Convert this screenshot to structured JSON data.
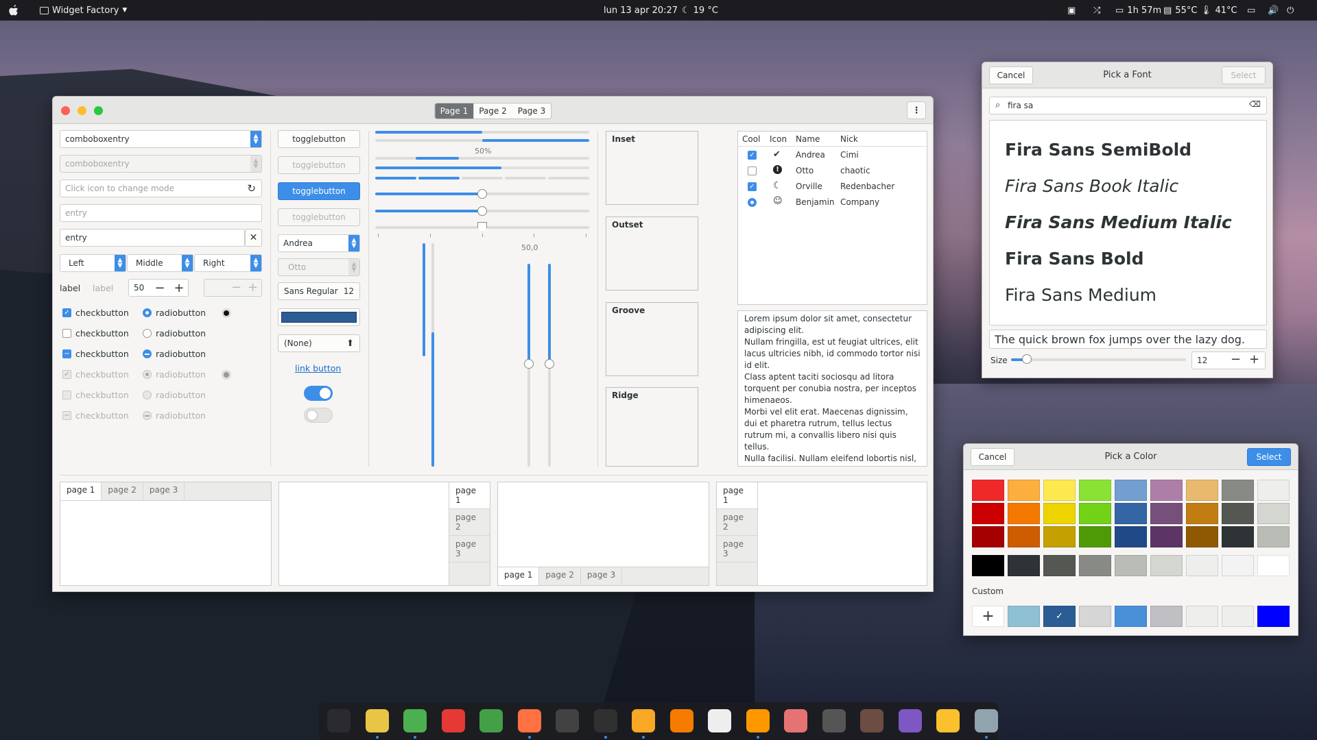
{
  "topbar": {
    "app_name": "Widget Factory",
    "datetime": "lun 13 apr  20:27",
    "weather": "19 °C",
    "battery": "1h 57m",
    "cpu_temp": "55°C",
    "gpu_temp": "41°C"
  },
  "main_window": {
    "stack_tabs": [
      "Page 1",
      "Page 2",
      "Page 3"
    ],
    "col1": {
      "combo1": "comboboxentry",
      "combo2": "comboboxentry",
      "mode_placeholder": "Click icon to change mode",
      "entry_placeholder": "entry",
      "entry_value": "entry",
      "segments": [
        "Left",
        "Middle",
        "Right"
      ],
      "label1": "label",
      "label2": "label",
      "spin_value": "50",
      "checks": [
        "checkbutton",
        "checkbutton",
        "checkbutton",
        "checkbutton",
        "checkbutton",
        "checkbutton"
      ],
      "radios": [
        "radiobutton",
        "radiobutton",
        "radiobutton",
        "radiobutton",
        "radiobutton",
        "radiobutton"
      ]
    },
    "col2": {
      "toggles": [
        "togglebutton",
        "togglebutton",
        "togglebutton",
        "togglebutton"
      ],
      "combo_active": "Andrea",
      "combo_disabled": "Otto",
      "font_name": "Sans Regular",
      "font_size": "12",
      "color_value": "#2b5c94",
      "file_value": "(None)",
      "link": "link button",
      "switch_on": true,
      "switch_off": false
    },
    "col3": {
      "progress_label": "50%",
      "scale_value": "50,0",
      "progress1": 0.5,
      "scale1": 0.5,
      "scale2": 0.5
    },
    "frames": [
      "Inset",
      "Outset",
      "Groove",
      "Ridge"
    ],
    "tree": {
      "headers": [
        "Cool",
        "Icon",
        "Name",
        "Nick"
      ],
      "rows": [
        {
          "name": "Andrea",
          "nick": "Cimi",
          "check": "on",
          "icon": "check-circle-icon"
        },
        {
          "name": "Otto",
          "nick": "chaotic",
          "check": "off",
          "icon": "exclamation-icon"
        },
        {
          "name": "Orville",
          "nick": "Redenbacher",
          "check": "on",
          "icon": "moon-icon"
        },
        {
          "name": "Benjamin",
          "nick": "Company",
          "check": "radio",
          "icon": "face-icon"
        }
      ]
    },
    "lorem": [
      "Lorem ipsum dolor sit amet, consectetur adipiscing elit.",
      "Nullam fringilla, est ut feugiat ultrices, elit lacus ultricies nibh, id commodo tortor nisi id elit.",
      "Class aptent taciti sociosqu ad litora torquent per conubia nostra, per inceptos himenaeos.",
      "Morbi vel elit erat. Maecenas dignissim, dui et pharetra rutrum, tellus lectus rutrum mi, a convallis libero nisi quis tellus.",
      "Nulla facilisi. Nullam eleifend lobortis nisl, in porttitor tellus malesuada vitae."
    ],
    "notebook_tabs": [
      "page 1",
      "page 2",
      "page 3"
    ]
  },
  "font_dialog": {
    "title": "Pick a Font",
    "cancel": "Cancel",
    "select": "Select",
    "search": "fira sa",
    "fonts": [
      "Fira Sans SemiBold",
      "Fira Sans Book Italic",
      "Fira Sans Medium Italic",
      "Fira Sans Bold",
      "Fira Sans Medium"
    ],
    "preview": "The quick brown fox jumps over the lazy dog.",
    "size_label": "Size",
    "size_value": "12"
  },
  "color_dialog": {
    "title": "Pick a Color",
    "cancel": "Cancel",
    "select": "Select",
    "custom_label": "Custom",
    "palette": [
      [
        "#ef2929",
        "#fcaf3e",
        "#fce94f",
        "#8ae234",
        "#729fcf",
        "#ad7fa8",
        "#e9b96e",
        "#888a85",
        "#eeeeec"
      ],
      [
        "#cc0000",
        "#f57900",
        "#edd400",
        "#73d216",
        "#3465a4",
        "#75507b",
        "#c17d11",
        "#555753",
        "#d3d7cf"
      ],
      [
        "#a40000",
        "#ce5c00",
        "#c4a000",
        "#4e9a06",
        "#204a87",
        "#5c3566",
        "#8f5902",
        "#2e3436",
        "#babdb6"
      ]
    ],
    "grays": [
      "#000000",
      "#2e3436",
      "#555753",
      "#888a85",
      "#babdb6",
      "#d3d7cf",
      "#eeeeec",
      "#f3f3f3",
      "#ffffff"
    ],
    "custom": [
      "#8fc1d4",
      "#2b5c94",
      "#d6d6d6",
      "#4a90d9",
      "#c0c0c4",
      "#eeeeec",
      "#eeeeec",
      "#0000ff"
    ]
  }
}
